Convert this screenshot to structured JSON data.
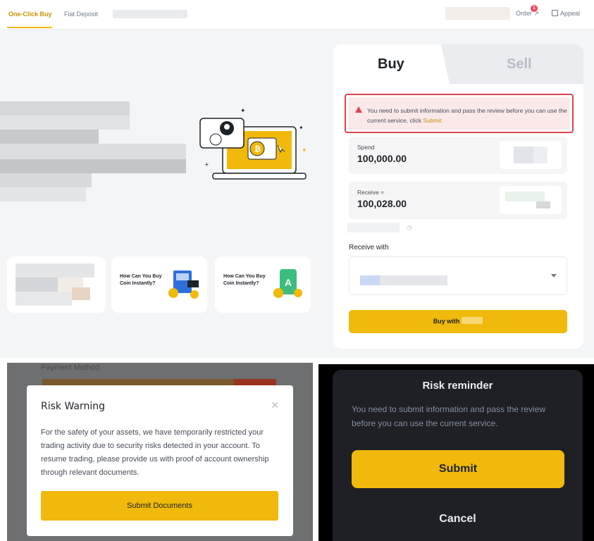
{
  "nav": {
    "tab_one_click": "One-Click Buy",
    "tab_fiat": "Fiat Deposit",
    "order_label": "Order",
    "order_badge": "1",
    "appeal_label": "Appeal"
  },
  "promo_cards": [
    {
      "text": "How Can You Buy Coin Instantly?"
    },
    {
      "text": "How Can You Buy Coin Instantly?"
    }
  ],
  "trade": {
    "buy_tab": "Buy",
    "sell_tab": "Sell",
    "warning_text": "You need to submit information and pass the review before you can use the current service, click ",
    "warning_link": "Submit",
    "spend_label": "Spend",
    "spend_value": "100,000.00",
    "receive_label": "Receive ≈",
    "receive_value": "100,028.00",
    "receive_with_label": "Receive with",
    "buy_button": "Buy with"
  },
  "risk_warning": {
    "ghost_label": "Payment Method",
    "title": "Risk Warning",
    "close_glyph": "✕",
    "body": "For the safety of your assets, we have temporarily restricted your trading activity due to security risks detected in your account. To resume trading, please provide us with proof of account ownership through relevant documents.",
    "button": "Submit Documents"
  },
  "risk_reminder": {
    "title": "Risk reminder",
    "body": "You need to submit information and pass the review before you can use the current service.",
    "submit": "Submit",
    "cancel": "Cancel"
  },
  "colors": {
    "accent": "#f0b90b",
    "accent_text": "#c99400",
    "error": "#e0434c"
  }
}
